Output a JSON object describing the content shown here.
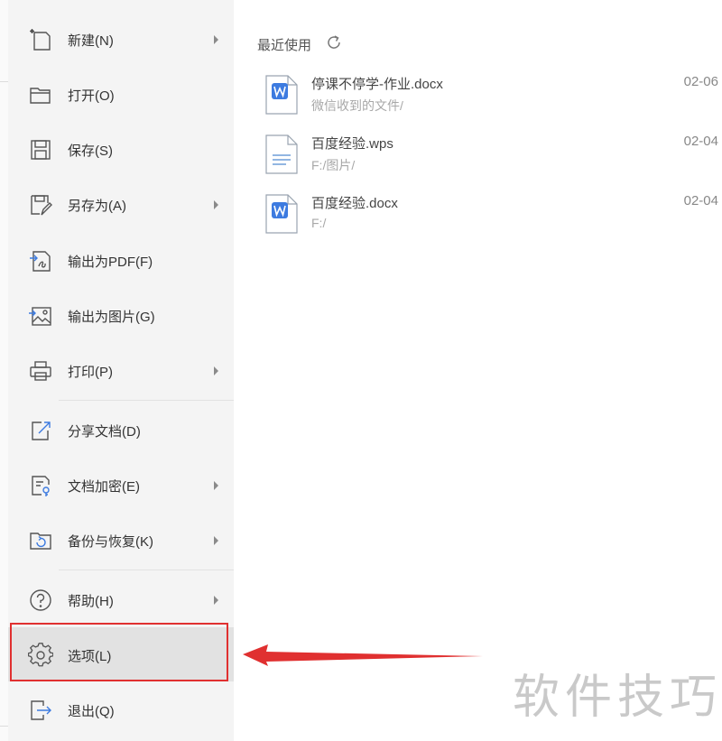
{
  "menu": {
    "items": [
      {
        "label": "新建(N)",
        "icon": "new-document-icon",
        "submenu": true
      },
      {
        "label": "打开(O)",
        "icon": "folder-open-icon",
        "submenu": false
      },
      {
        "label": "保存(S)",
        "icon": "save-icon",
        "submenu": false
      },
      {
        "label": "另存为(A)",
        "icon": "save-as-icon",
        "submenu": true
      },
      {
        "label": "输出为PDF(F)",
        "icon": "export-pdf-icon",
        "submenu": false
      },
      {
        "label": "输出为图片(G)",
        "icon": "export-image-icon",
        "submenu": false
      },
      {
        "label": "打印(P)",
        "icon": "printer-icon",
        "submenu": true
      },
      {
        "label": "分享文档(D)",
        "icon": "share-icon",
        "submenu": false
      },
      {
        "label": "文档加密(E)",
        "icon": "encrypt-document-icon",
        "submenu": true
      },
      {
        "label": "备份与恢复(K)",
        "icon": "backup-restore-icon",
        "submenu": true
      },
      {
        "label": "帮助(H)",
        "icon": "help-icon",
        "submenu": true
      },
      {
        "label": "选项(L)",
        "icon": "gear-icon",
        "submenu": false,
        "selected": true
      },
      {
        "label": "退出(Q)",
        "icon": "exit-icon",
        "submenu": false
      }
    ]
  },
  "recent": {
    "title": "最近使用",
    "files": [
      {
        "name": "停课不停学-作业.docx",
        "path": "微信收到的文件/",
        "date": "02-06",
        "type": "word-document-icon"
      },
      {
        "name": "百度经验.wps",
        "path": "F:/图片/",
        "date": "02-04",
        "type": "wps-document-icon"
      },
      {
        "name": "百度经验.docx",
        "path": "F:/",
        "date": "02-04",
        "type": "word-document-icon"
      }
    ]
  },
  "watermark": "软件技巧",
  "colors": {
    "menu_bg": "#f4f4f4",
    "selected_bg": "#e2e2e2",
    "annotation_red": "#e03030",
    "word_blue": "#3d7be0"
  }
}
